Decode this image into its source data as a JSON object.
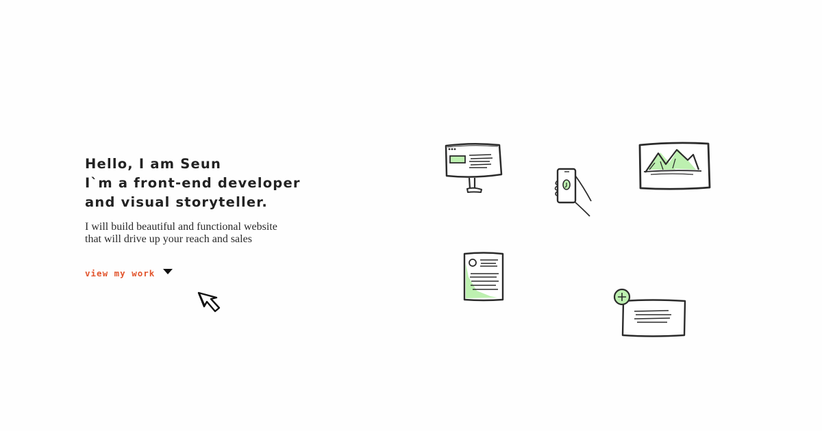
{
  "hero": {
    "headline": [
      "Hello, I am Seun",
      "I`m a front-end developer",
      "and visual storyteller."
    ],
    "tagline": "I will build beautiful and functional website that will drive up your reach and sales",
    "cta_label": "view my work"
  },
  "icons": {
    "cta": "caret-down-icon",
    "cursor": "cursor-arrow-icon",
    "illustrations": [
      "desktop-monitor-icon",
      "phone-in-hand-icon",
      "landscape-image-icon",
      "document-icon",
      "add-card-icon"
    ]
  },
  "colors": {
    "accent": "#e2542c",
    "text": "#222222",
    "sketch_stroke": "#2b2b2b",
    "highlight_green": "#bdf0b0",
    "background": "#fefefe"
  }
}
